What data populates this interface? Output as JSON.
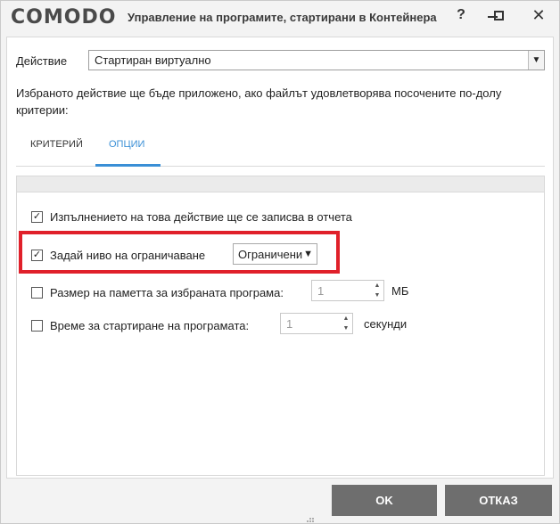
{
  "window": {
    "logo": "COMODO",
    "title": "Управление на програмите, стартирани в Контейнера",
    "help_glyph": "?",
    "close_glyph": "✕"
  },
  "action": {
    "label": "Действие",
    "selected": "Стартиран виртуално"
  },
  "description": "Избраното действие ще бъде приложено, ако файлът удовлетворява посочените по-долу критерии:",
  "tabs": [
    {
      "label": "КРИТЕРИЙ",
      "active": false
    },
    {
      "label": "ОПЦИИ",
      "active": true
    }
  ],
  "options": {
    "log_action": {
      "label": "Изпълнението на това действие ще се записва в отчета",
      "checked": true
    },
    "restriction": {
      "label": "Задай ниво на ограничаване",
      "checked": true,
      "selected": "Ограничени"
    },
    "memory": {
      "label": "Размер на паметта за избраната програма:",
      "checked": false,
      "value": "1",
      "unit": "МБ"
    },
    "runtime": {
      "label": "Време за стартиране на програмата:",
      "checked": false,
      "value": "1",
      "unit": "секунди"
    }
  },
  "buttons": {
    "ok": "OK",
    "cancel": "ОТКАЗ"
  },
  "colors": {
    "accent": "#3a8fd6",
    "highlight": "#e0202a",
    "button": "#6e6e6e"
  }
}
